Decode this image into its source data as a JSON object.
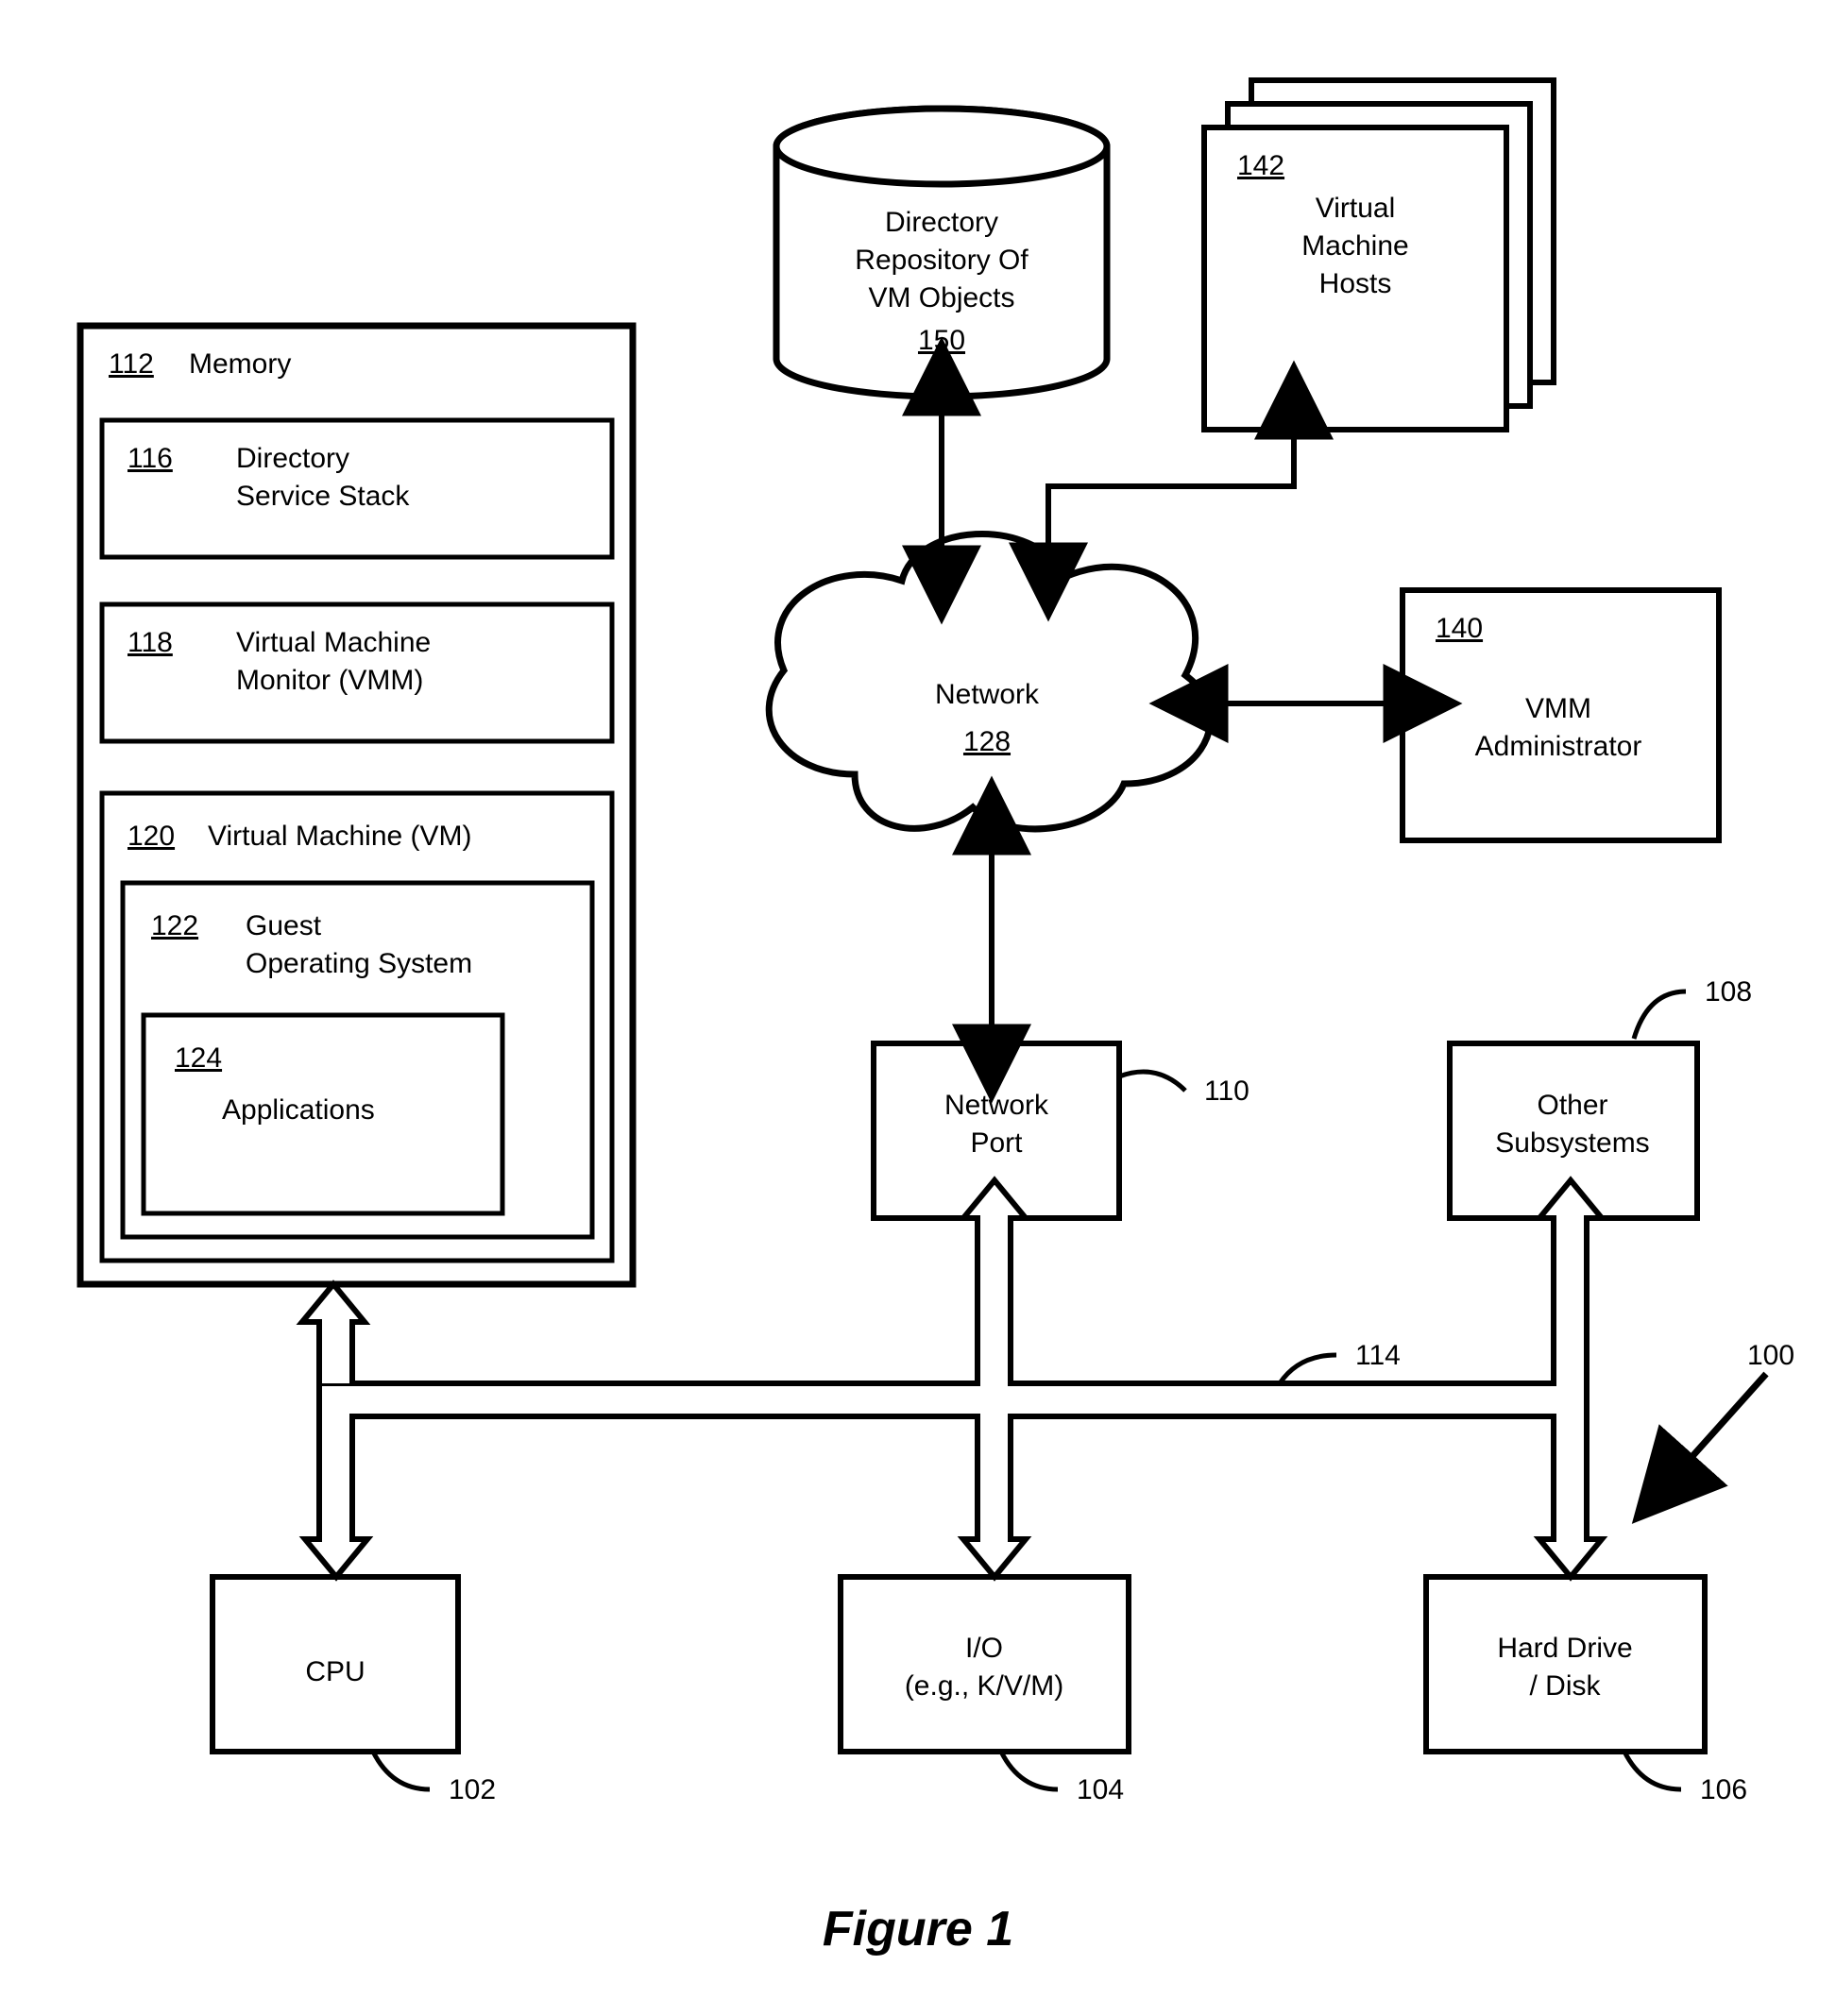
{
  "memory": {
    "num": "112",
    "label": "Memory",
    "dir_stack": {
      "num": "116",
      "line1": "Directory",
      "line2": "Service Stack"
    },
    "vmm": {
      "num": "118",
      "line1": "Virtual Machine",
      "line2": "Monitor (VMM)"
    },
    "vm": {
      "num": "120",
      "label": "Virtual Machine (VM)",
      "guest_os": {
        "num": "122",
        "line1": "Guest",
        "line2": "Operating System"
      },
      "apps": {
        "num": "124",
        "label": "Applications"
      }
    }
  },
  "directory_repo": {
    "num": "150",
    "line1": "Directory",
    "line2": "Repository Of",
    "line3": "VM Objects"
  },
  "vm_hosts": {
    "num": "142",
    "line1": "Virtual",
    "line2": "Machine",
    "line3": "Hosts"
  },
  "network": {
    "num": "128",
    "label": "Network"
  },
  "vmm_admin": {
    "num": "140",
    "line1": "VMM",
    "line2": "Administrator"
  },
  "network_port": {
    "num": "110",
    "line1": "Network",
    "line2": "Port"
  },
  "other_subsystems": {
    "num": "108",
    "line1": "Other",
    "line2": "Subsystems"
  },
  "cpu": {
    "num": "102",
    "label": "CPU"
  },
  "io": {
    "num": "104",
    "line1": "I/O",
    "line2": "(e.g., K/V/M)"
  },
  "hard_drive": {
    "num": "106",
    "line1": "Hard Drive",
    "line2": "/ Disk"
  },
  "bus": {
    "num": "114"
  },
  "system": {
    "num": "100"
  },
  "figure": "Figure 1"
}
